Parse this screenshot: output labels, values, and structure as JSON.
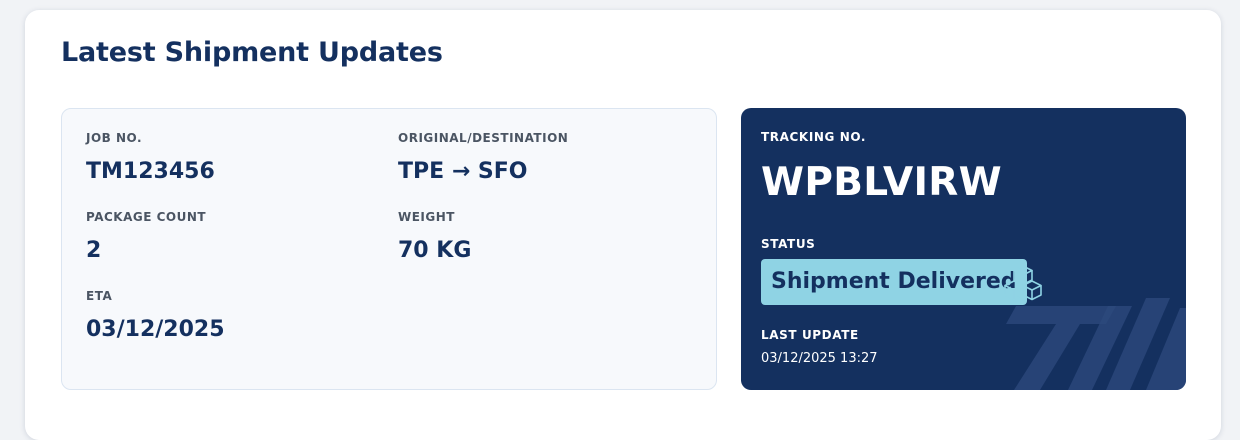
{
  "card": {
    "title": "Latest Shipment Updates"
  },
  "details": {
    "job": {
      "label": "JOB NO.",
      "value": "TM123456"
    },
    "route": {
      "label": "ORIGINAL/DESTINATION",
      "value": "TPE → SFO"
    },
    "packages": {
      "label": "PACKAGE COUNT",
      "value": "2"
    },
    "weight": {
      "label": "WEIGHT",
      "value": "70 KG"
    },
    "eta": {
      "label": "ETA",
      "value": "03/12/2025"
    }
  },
  "tracking": {
    "label": "TRACKING NO.",
    "number": "WPBLVIRW",
    "status_label": "STATUS",
    "status_value": "Shipment Delivered",
    "status_icon": "boxes-icon",
    "last_update_label": "LAST UPDATE",
    "last_update_value": "03/12/2025 13:27"
  },
  "colors": {
    "navy": "#14305f",
    "badge": "#8fd3e4",
    "panel_bg": "#f7f9fc"
  }
}
